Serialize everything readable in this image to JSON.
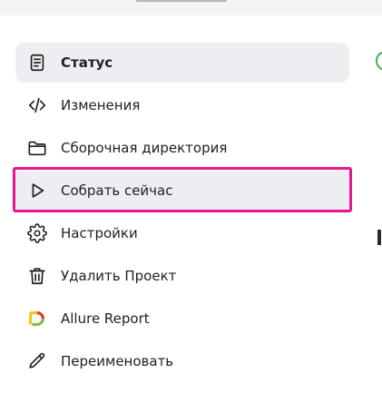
{
  "sidebar": {
    "items": [
      {
        "id": "status",
        "label": "Статус",
        "icon": "document-icon"
      },
      {
        "id": "changes",
        "label": "Изменения",
        "icon": "code-icon"
      },
      {
        "id": "build-dir",
        "label": "Сборочная директория",
        "icon": "folder-icon"
      },
      {
        "id": "build-now",
        "label": "Собрать сейчас",
        "icon": "play-icon"
      },
      {
        "id": "settings",
        "label": "Настройки",
        "icon": "gear-icon"
      },
      {
        "id": "delete-project",
        "label": "Удалить Проект",
        "icon": "trash-icon"
      },
      {
        "id": "allure-report",
        "label": "Allure Report",
        "icon": "allure-logo-icon"
      },
      {
        "id": "rename",
        "label": "Переименовать",
        "icon": "pencil-icon"
      }
    ],
    "active_item": "Статус",
    "highlighted_item": "Собрать сейчас"
  },
  "colors": {
    "highlight_border": "#e8158f",
    "active_background": "#eeeef2",
    "status_green": "#3ab14b",
    "allure_yellow": "#f2c40d",
    "allure_red": "#e4322b",
    "allure_green": "#7bc043"
  }
}
